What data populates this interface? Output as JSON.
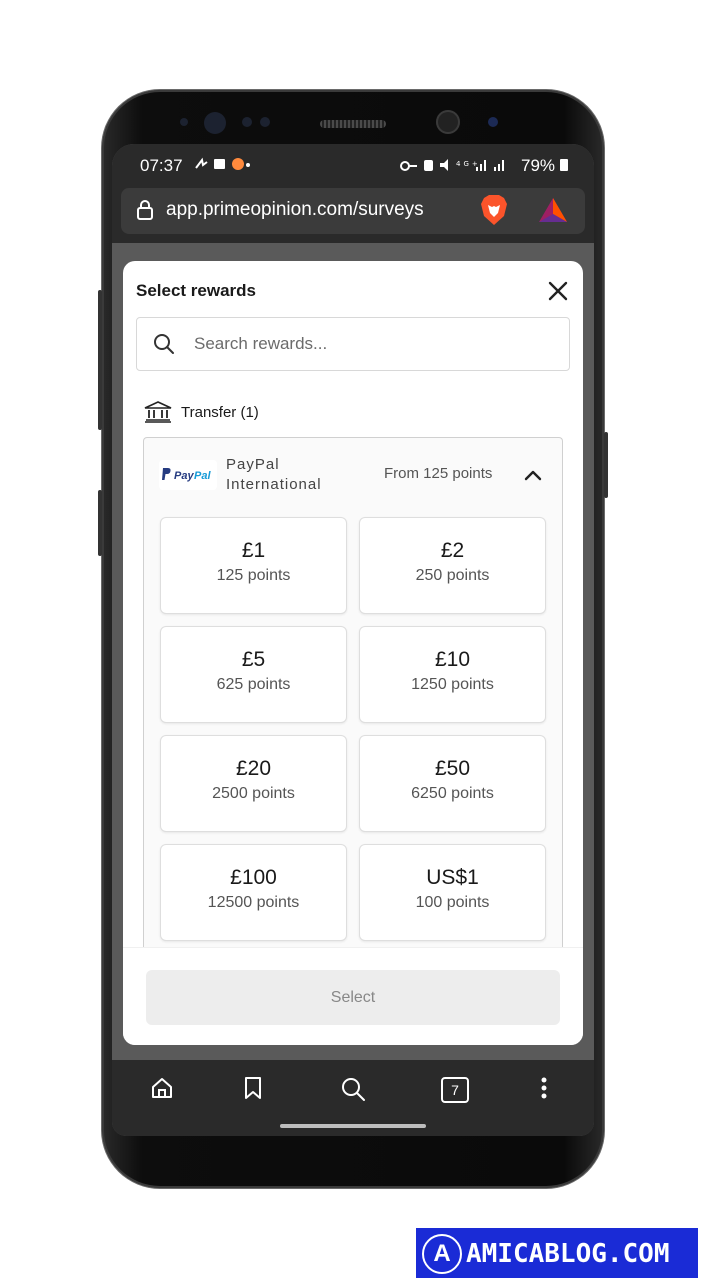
{
  "status_bar": {
    "time": "07:37",
    "battery": "79%",
    "network": "4G+"
  },
  "browser": {
    "url": "app.primeopinion.com/surveys",
    "tab_count": "7"
  },
  "modal": {
    "title": "Select rewards",
    "search_placeholder": "Search rewards...",
    "category_label": "Transfer (1)",
    "provider": {
      "name": "PayPal International",
      "from_text": "From 125 points",
      "logo_text": "PayPal"
    },
    "rewards": [
      {
        "amount": "£1",
        "points": "125 points"
      },
      {
        "amount": "£2",
        "points": "250 points"
      },
      {
        "amount": "£5",
        "points": "625 points"
      },
      {
        "amount": "£10",
        "points": "1250 points"
      },
      {
        "amount": "£20",
        "points": "2500 points"
      },
      {
        "amount": "£50",
        "points": "6250 points"
      },
      {
        "amount": "£100",
        "points": "12500 points"
      },
      {
        "amount": "US$1",
        "points": "100 points"
      }
    ],
    "select_label": "Select"
  },
  "watermark": {
    "badge": "A",
    "text": "AMICABLOG.COM"
  }
}
